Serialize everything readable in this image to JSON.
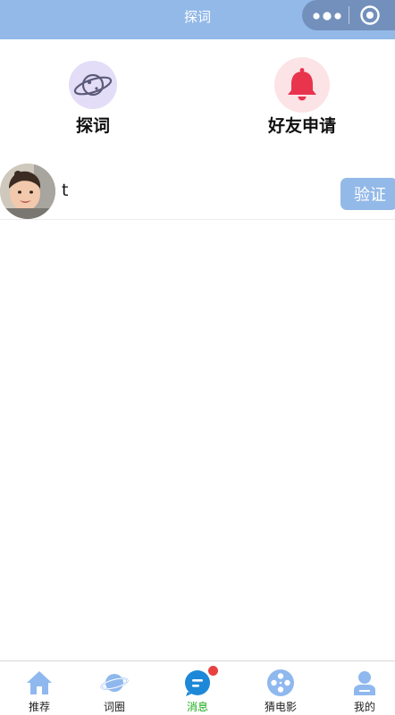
{
  "header": {
    "title": "探词",
    "background_color": "#93b9e8"
  },
  "capsule": {
    "more_icon": "more-dots-icon",
    "close_icon": "target-circle-icon"
  },
  "entries": [
    {
      "label": "探词",
      "icon": "planet-icon",
      "icon_bg": "#e4ddf7"
    },
    {
      "label": "好友申请",
      "icon": "bell-icon",
      "icon_bg": "#fce3e6"
    }
  ],
  "requests": [
    {
      "username": "t",
      "verify_label": "验证"
    }
  ],
  "tabbar": {
    "active_color": "#1aad19",
    "tabs": [
      {
        "label": "推荐",
        "icon": "home-icon"
      },
      {
        "label": "词圈",
        "icon": "planet-icon"
      },
      {
        "label": "消息",
        "icon": "message-icon",
        "active": true,
        "badge": true
      },
      {
        "label": "猜电影",
        "icon": "film-reel-icon"
      },
      {
        "label": "我的",
        "icon": "user-icon"
      }
    ]
  }
}
